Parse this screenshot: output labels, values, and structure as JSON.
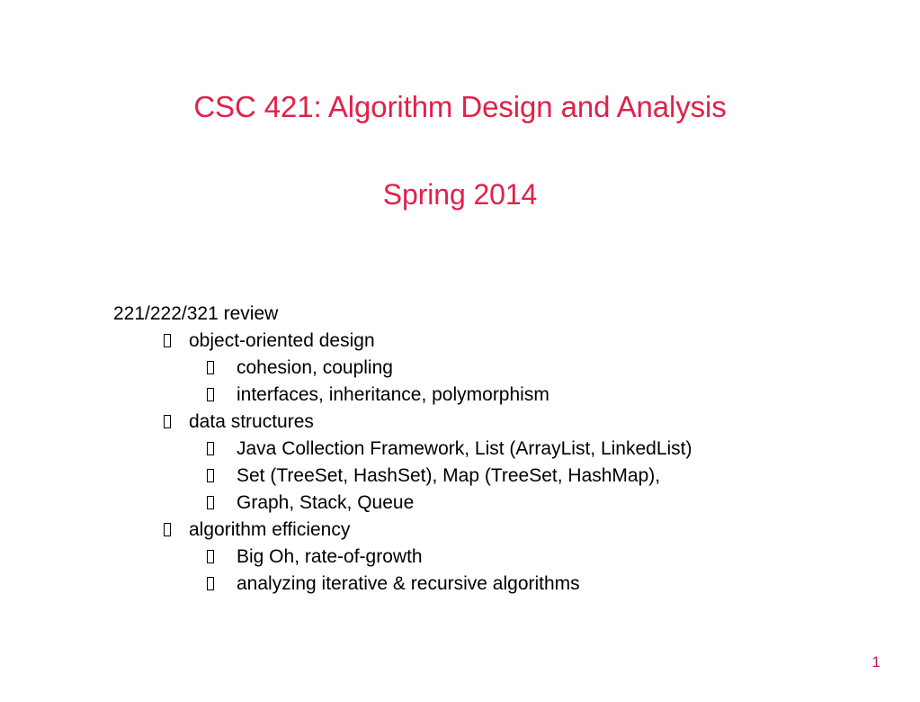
{
  "slide": {
    "background_color": "#ffffff",
    "accent_color": "#e0214a",
    "body_text_color": "#000000"
  },
  "title": {
    "line1": "CSC 421: Algorithm Design and Analysis",
    "subtitle": "Spring 2014"
  },
  "outline": [
    {
      "level": 0,
      "bullet": false,
      "text": "221/222/321 review"
    },
    {
      "level": 1,
      "bullet": true,
      "text": "object-oriented design"
    },
    {
      "level": 2,
      "bullet": true,
      "text": "cohesion, coupling"
    },
    {
      "level": 2,
      "bullet": true,
      "text": "interfaces, inheritance, polymorphism"
    },
    {
      "level": 1,
      "bullet": true,
      "text": "data structures"
    },
    {
      "level": 2,
      "bullet": true,
      "text": "Java Collection Framework, List (ArrayList, LinkedList)"
    },
    {
      "level": 2,
      "bullet": true,
      "text": "Set (TreeSet, HashSet), Map (TreeSet, HashMap),"
    },
    {
      "level": 2,
      "bullet": true,
      "text": "Graph, Stack, Queue"
    },
    {
      "level": 1,
      "bullet": true,
      "text": "algorithm efficiency"
    },
    {
      "level": 2,
      "bullet": true,
      "text": "Big Oh, rate-of-growth"
    },
    {
      "level": 2,
      "bullet": true,
      "text": "analyzing iterative & recursive algorithms"
    }
  ],
  "footer": {
    "page_number": "1"
  }
}
